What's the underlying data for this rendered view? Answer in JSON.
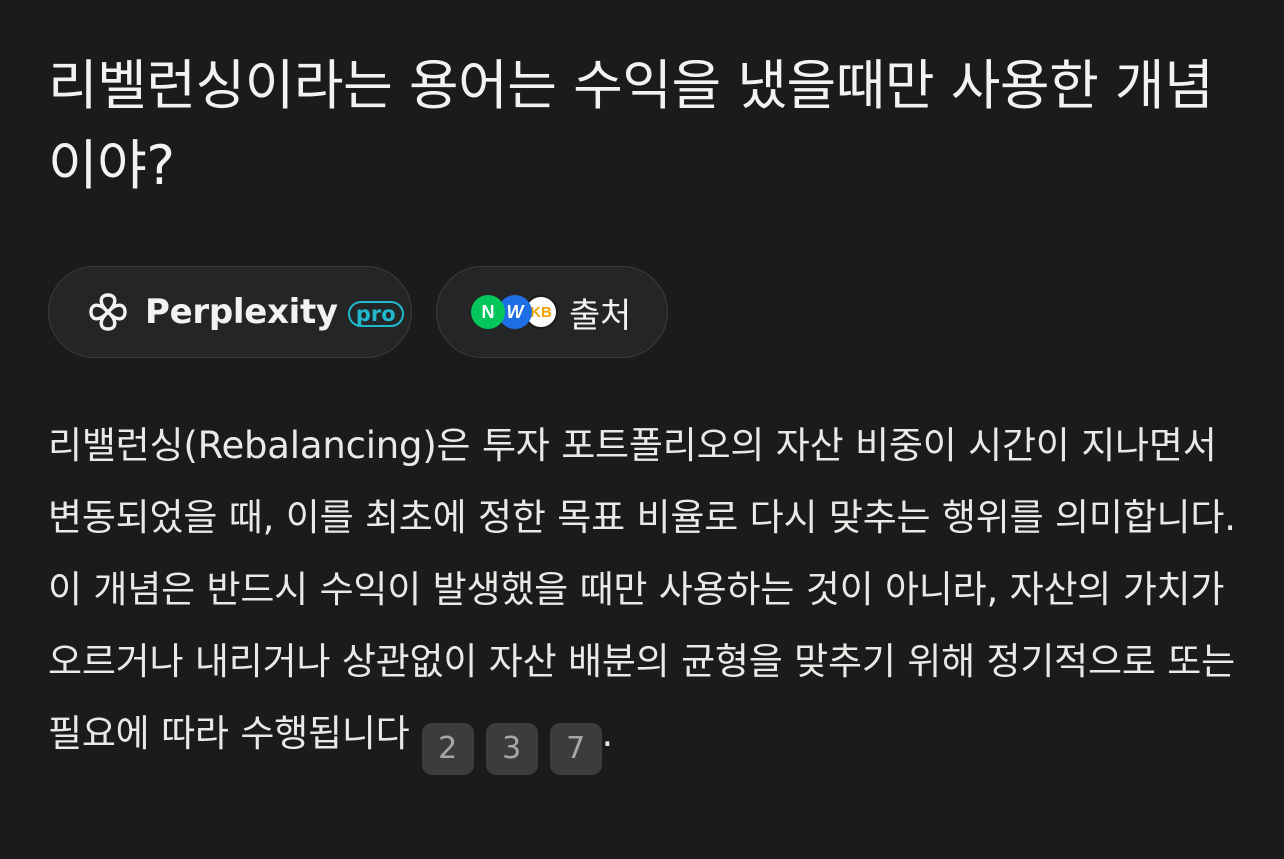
{
  "question": "리벨런싱이라는 용어는 수익을 냈을때만 사용한 개념이야?",
  "chips": {
    "model_label": "Perplexity",
    "model_badge": "pro",
    "sources_label": "출처",
    "source_logos": [
      {
        "icon": "naver-logo-icon",
        "text": "N"
      },
      {
        "icon": "w-logo-icon",
        "text": "W"
      },
      {
        "icon": "kb-logo-icon",
        "text": "KB"
      }
    ]
  },
  "answer": {
    "text": "리밸런싱(Rebalancing)은 투자 포트폴리오의 자산 비중이 시간이 지나면서 변동되었을 때, 이를 최초에 정한 목표 비율로 다시 맞추는 행위를 의미합니다. 이 개념은 반드시 수익이 발생했을 때만 사용하는 것이 아니라, 자산의 가치가 오르거나 내리거나 상관없이 자산 배분의 균형을 맞추기 위해 정기적으로 또는 필요에 따라 수행됩니다",
    "citations": [
      "2",
      "3",
      "7"
    ],
    "end_punct": "."
  },
  "colors": {
    "background": "#1b1b1c",
    "chip_background": "#232526",
    "accent_pro": "#20b8cd",
    "citation_background": "#3b3c3d"
  }
}
